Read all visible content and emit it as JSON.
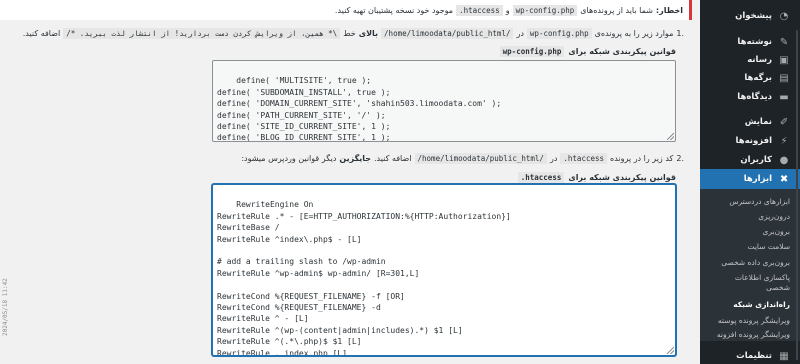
{
  "warning": {
    "label": "اخطار:",
    "text_1": "شما باید از پرونده‌های",
    "file_1": "wp-config.php",
    "conj": "و",
    "file_2": ".htaccess",
    "text_2": "موجود خود نسخه پشتیبان تهیه کنید."
  },
  "step1": {
    "number": ".1",
    "text_1": "موارد زیر را به پرونده‌ی",
    "file": "wp-config.php",
    "text_2": "در",
    "path": "/home/limoodata/public_html/",
    "above_label": "بالای",
    "text_3": "خط",
    "line": "/* .همین، از ویرایش کردن دست بردارید! از انتشار لذت ببرید *\\",
    "text_4": "اضافه کنید."
  },
  "step1_label": {
    "text": "قوانین پیکربندی شبکه برای",
    "file": "wp-config.php"
  },
  "code1": "define( 'MULTISITE', true );\ndefine( 'SUBDOMAIN_INSTALL', true );\ndefine( 'DOMAIN_CURRENT_SITE', 'shahin503.limoodata.com' );\ndefine( 'PATH_CURRENT_SITE', '/' );\ndefine( 'SITE_ID_CURRENT_SITE', 1 );\ndefine( 'BLOG_ID_CURRENT_SITE', 1 );",
  "step2": {
    "number": ".2",
    "text_1": "کد زیر را در پرونده",
    "file": ".htaccess",
    "text_2": "در",
    "path": "/home/limoodata/public_html/",
    "text_3": "اضافه کنید.",
    "replace_label": "جایگزین",
    "text_4": "دیگر قوانین وردپرس میشود:"
  },
  "step2_label": {
    "text": "قوانین پیکربندی شبکه برای",
    "file": ".htaccess"
  },
  "code2": "RewriteEngine On\nRewriteRule .* - [E=HTTP_AUTHORIZATION:%{HTTP:Authorization}]\nRewriteBase /\nRewriteRule ^index\\.php$ - [L]\n\n# add a trailing slash to /wp-admin\nRewriteRule ^wp-admin$ wp-admin/ [R=301,L]\n\nRewriteCond %{REQUEST_FILENAME} -f [OR]\nRewriteCond %{REQUEST_FILENAME} -d\nRewriteRule ^ - [L]\nRewriteRule ^(wp-(content|admin|includes).*) $1 [L]\nRewriteRule ^(.*\\.php)$ $1 [L]\nRewriteRule . index.php [L]",
  "side_stamp": "2024/05/18 11:42",
  "sidebar": {
    "items": [
      {
        "label": "پیشخوان",
        "icon": "dashboard-icon",
        "glyph": "◔"
      },
      {
        "label": "نوشته‌ها",
        "icon": "pin-icon",
        "glyph": "✎"
      },
      {
        "label": "رسانه",
        "icon": "media-icon",
        "glyph": "▣"
      },
      {
        "label": "برگه‌ها",
        "icon": "page-icon",
        "glyph": "▤"
      },
      {
        "label": "دیدگاه‌ها",
        "icon": "comments-icon",
        "glyph": "▬"
      },
      {
        "label": "نمایش",
        "icon": "appearance-icon",
        "glyph": "✐"
      },
      {
        "label": "افزونه‌ها",
        "icon": "plugins-icon",
        "glyph": "⚡"
      },
      {
        "label": "کاربران",
        "icon": "users-icon",
        "glyph": "●"
      },
      {
        "label": "ابزارها",
        "icon": "tools-icon",
        "glyph": "✖"
      },
      {
        "label": "تنظیمات",
        "icon": "settings-icon",
        "glyph": "▦"
      }
    ],
    "submenu": [
      "ابزارهای دردسترس",
      "درون‌ریزی",
      "برون‌بری",
      "سلامت سایت",
      "برون‌بری داده شخصی",
      "پاکسازی اطلاعات",
      "شخصی",
      "راه‌اندازی شبکه",
      "ویرایشگر پرونده پوسته",
      "ویرایشگر پرونده افزونه"
    ]
  }
}
